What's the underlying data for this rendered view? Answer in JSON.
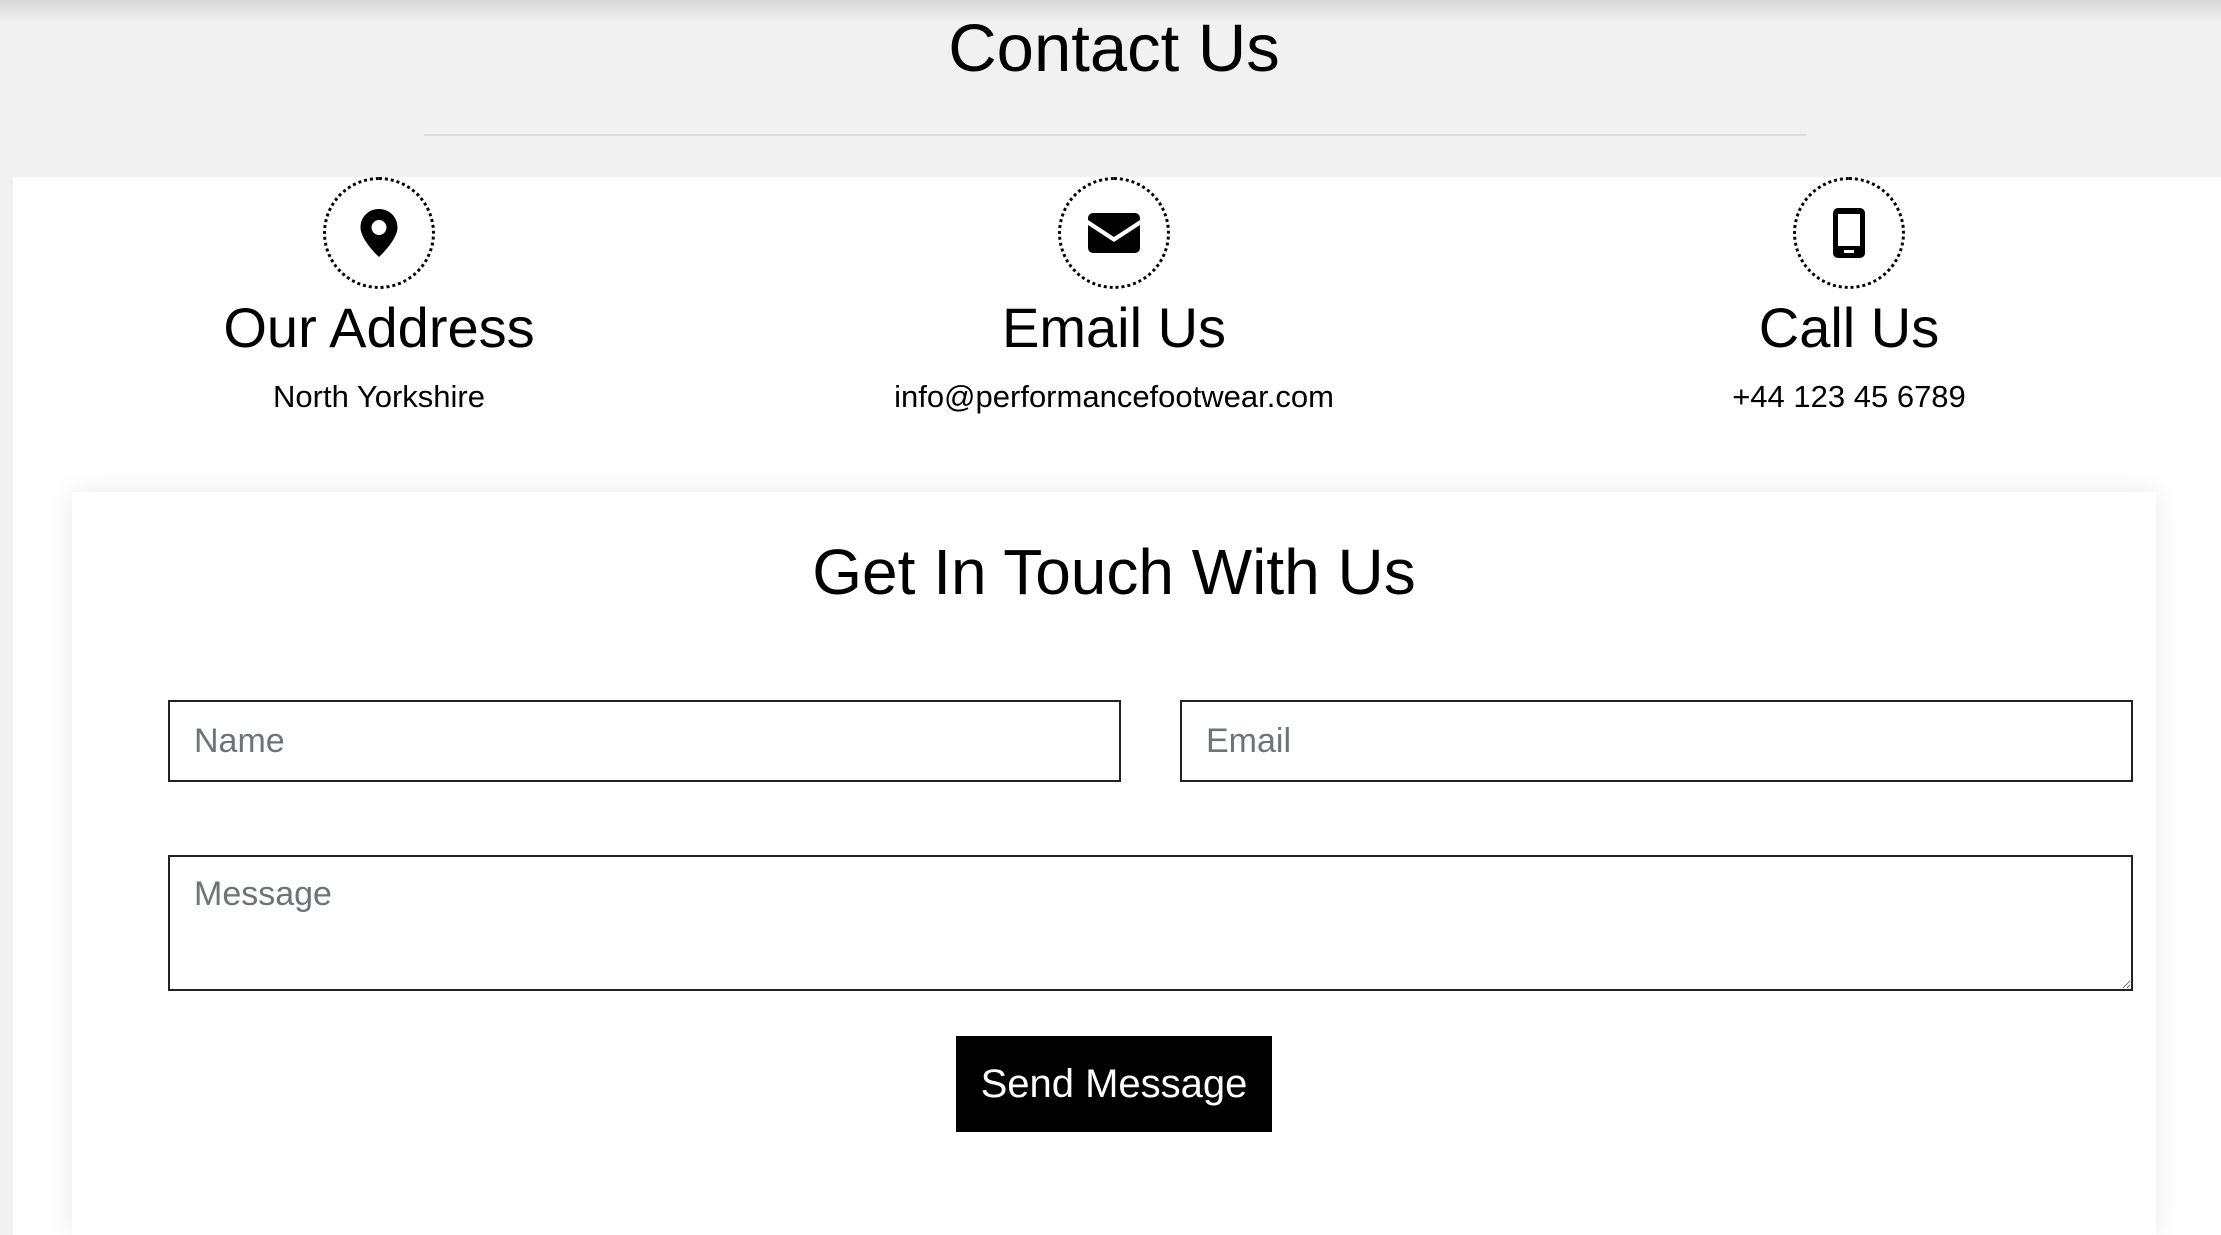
{
  "header": {
    "title": "Contact Us"
  },
  "info": [
    {
      "icon": "map-pin-icon",
      "title": "Our Address",
      "value": "North Yorkshire"
    },
    {
      "icon": "envelope-icon",
      "title": "Email Us",
      "value": "info@performancefootwear.com"
    },
    {
      "icon": "mobile-phone-icon",
      "title": "Call Us",
      "value": "+44 123 45 6789"
    }
  ],
  "form": {
    "title": "Get In Touch With Us",
    "name_placeholder": "Name",
    "email_placeholder": "Email",
    "message_placeholder": "Message",
    "submit_label": "Send Message"
  },
  "colors": {
    "background": "#f1f1f1",
    "panel": "#ffffff",
    "button": "#000000",
    "button_text": "#ffffff",
    "placeholder": "#6b737b"
  }
}
